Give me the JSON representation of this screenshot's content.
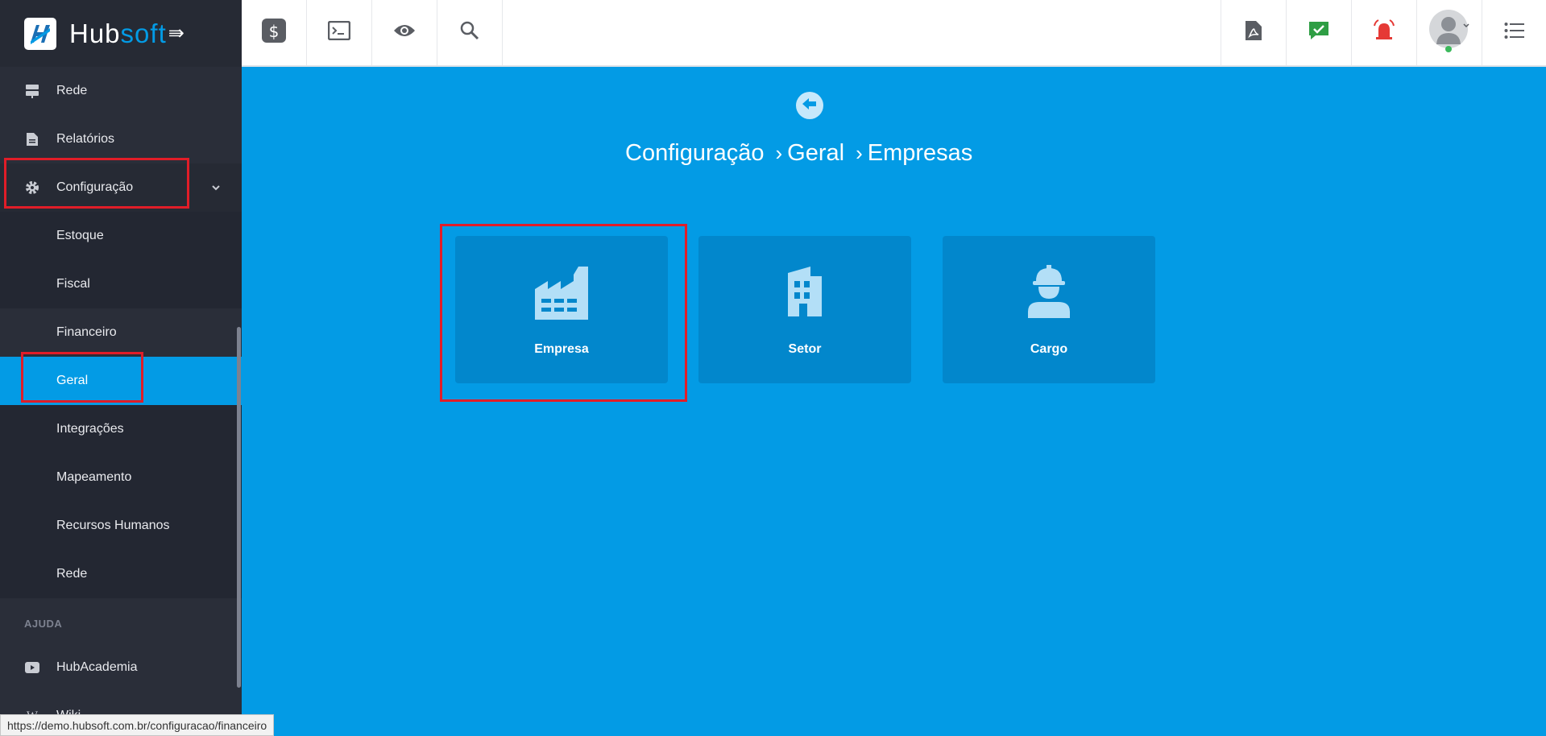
{
  "app": {
    "logo_hub": "Hub",
    "logo_soft": "soft"
  },
  "sidebar": {
    "items": [
      {
        "label": "Rede",
        "icon": "server-icon"
      },
      {
        "label": "Relatórios",
        "icon": "file-icon"
      },
      {
        "label": "Configuração",
        "icon": "gear-icon"
      },
      {
        "label": "Estoque"
      },
      {
        "label": "Fiscal"
      },
      {
        "label": "Financeiro"
      },
      {
        "label": "Geral"
      },
      {
        "label": "Integrações"
      },
      {
        "label": "Mapeamento"
      },
      {
        "label": "Recursos Humanos"
      },
      {
        "label": "Rede"
      }
    ],
    "section_help": "AJUDA",
    "help_items": [
      {
        "label": "HubAcademia",
        "icon": "youtube-icon"
      },
      {
        "label": "Wiki",
        "icon": "wikipedia-icon"
      }
    ]
  },
  "topbar": {
    "left_icons": [
      "dollar-icon",
      "terminal-icon",
      "eye-icon",
      "search-icon"
    ],
    "right_icons": [
      "pdf-icon",
      "chat-check-icon",
      "alarm-icon",
      "avatar",
      "list-icon"
    ]
  },
  "main": {
    "breadcrumb": [
      "Configuração",
      "Geral",
      "Empresas"
    ],
    "tiles": [
      {
        "label": "Empresa",
        "icon": "factory-icon"
      },
      {
        "label": "Setor",
        "icon": "building-icon"
      },
      {
        "label": "Cargo",
        "icon": "worker-icon"
      }
    ]
  },
  "statusbar": {
    "url": "https://demo.hubsoft.com.br/configuracao/financeiro"
  },
  "colors": {
    "accent": "#039be5",
    "sidebar": "#2a2e39",
    "highlight": "#e11d28"
  }
}
